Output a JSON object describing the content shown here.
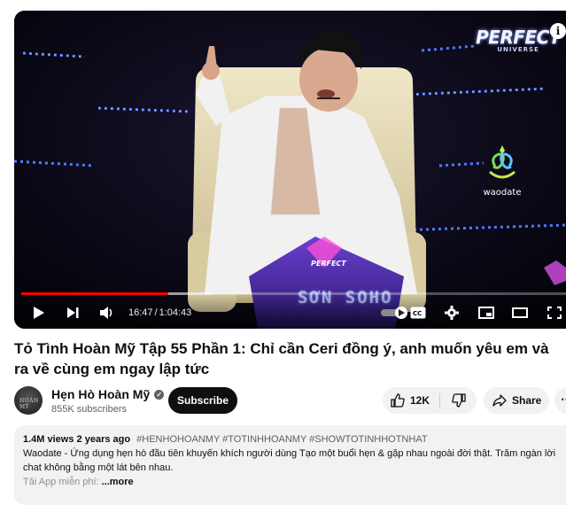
{
  "video": {
    "logo_main": "PERFECT",
    "logo_sub": "UNIVERSE",
    "info": "i",
    "sponsor": "waodate",
    "lower_third": "SƠN SOHO",
    "progress": 0.27,
    "buffered": 0.35,
    "current_time": "16:47",
    "time_separator": "/",
    "duration": "1:04:43"
  },
  "title": "Tỏ Tình Hoàn Mỹ Tập 55 Phần 1: Chỉ cần Ceri đồng ý, anh muốn yêu em và ra về cùng em ngay lập tức",
  "channel": {
    "name": "Hẹn Hò Hoàn Mỹ",
    "subscribers": "855K subscribers",
    "avatar_text": "HOÀN MỸ"
  },
  "actions": {
    "subscribe": "Subscribe",
    "likes": "12K",
    "share": "Share"
  },
  "description": {
    "views": "1.4M views",
    "age": "2 years ago",
    "hashtags": "#HENHOHOANMY #TOTINHHOANMY #SHOWTOTINHHOTNHAT",
    "text": "Waodate - Ứng dụng hẹn hò đầu tiên khuyến khích người dùng Tạo một buổi hẹn & gặp nhau ngoài đời thật. Trăm ngàn lời chat không bằng một lát bên nhau.",
    "line3": "Tải App miễn phí:",
    "more": "...more"
  },
  "colors": {
    "accent": "#ff0000",
    "subscribe_bg": "#0f0f0f",
    "pill_bg": "#f2f2f2"
  }
}
